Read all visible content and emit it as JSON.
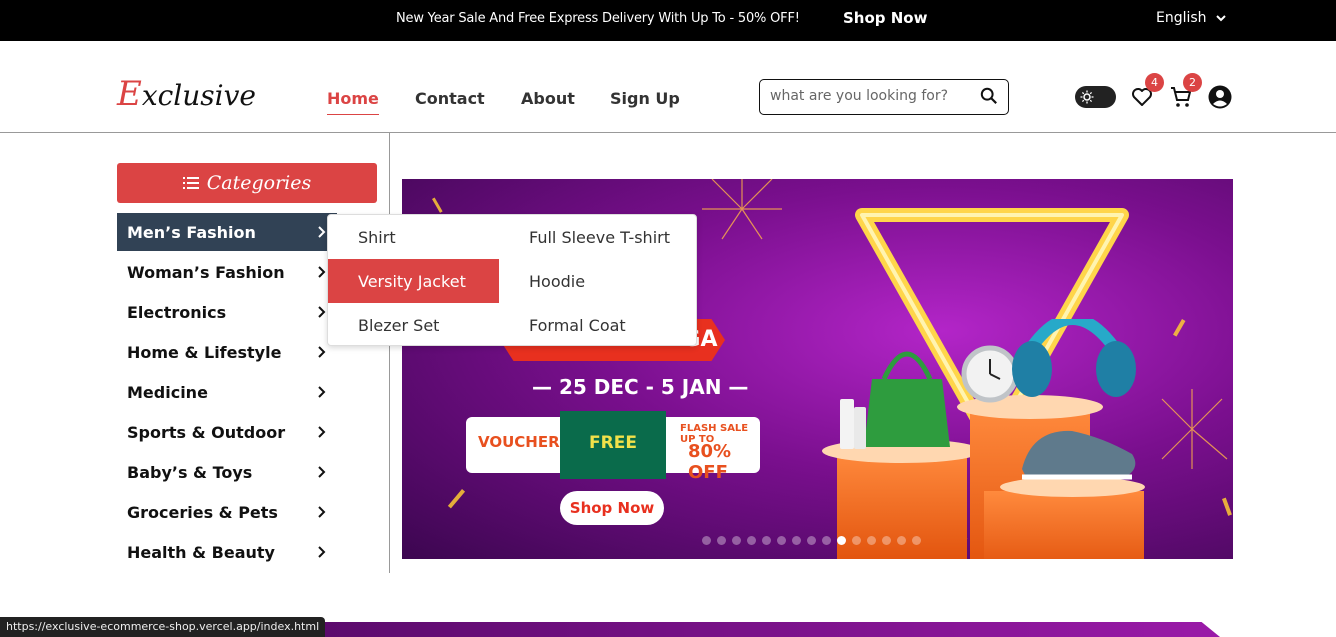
{
  "topbar": {
    "promo": "New Year Sale And Free Express Delivery With Up To - 50% OFF!",
    "shop_now": "Shop Now",
    "language": "English"
  },
  "header": {
    "logo": {
      "first": "E",
      "rest": "xclusive"
    },
    "nav": [
      "Home",
      "Contact",
      "About",
      "Sign Up"
    ],
    "active_nav": "Home",
    "search_placeholder": "what are you looking for?",
    "wishlist_count": "4",
    "cart_count": "2"
  },
  "sidebar": {
    "categories_label": "Categories",
    "items": [
      "Men’s Fashion",
      "Woman’s Fashion",
      "Electronics",
      "Home & Lifestyle",
      "Medicine",
      "Sports & Outdoor",
      "Baby’s & Toys",
      "Groceries & Pets",
      "Health & Beauty"
    ],
    "active_item": "Men’s Fashion"
  },
  "submenu": {
    "items": [
      "Shirt",
      "Full Sleeve T-shirt",
      "Versity Jacket",
      "Hoodie",
      "Blezer Set",
      "Formal Coat"
    ],
    "active_item": "Versity Jacket"
  },
  "banner": {
    "sale_text": "NEW YEAR MEGA SALE",
    "dates": "— 25 DEC - 5 JAN —",
    "voucher": "VOUCHER MAX",
    "free_delivery": "FREE DELIVERY",
    "flash": "FLASH SALE UP TO",
    "flash_pct": "80% OFF",
    "shop_now": "Shop Now",
    "slide_count": 15,
    "active_slide": 10
  },
  "status_url": "https://exclusive-ecommerce-shop.vercel.app/index.html",
  "colors": {
    "accent": "#db4444",
    "active_category": "#314255",
    "topbar": "#000000"
  }
}
